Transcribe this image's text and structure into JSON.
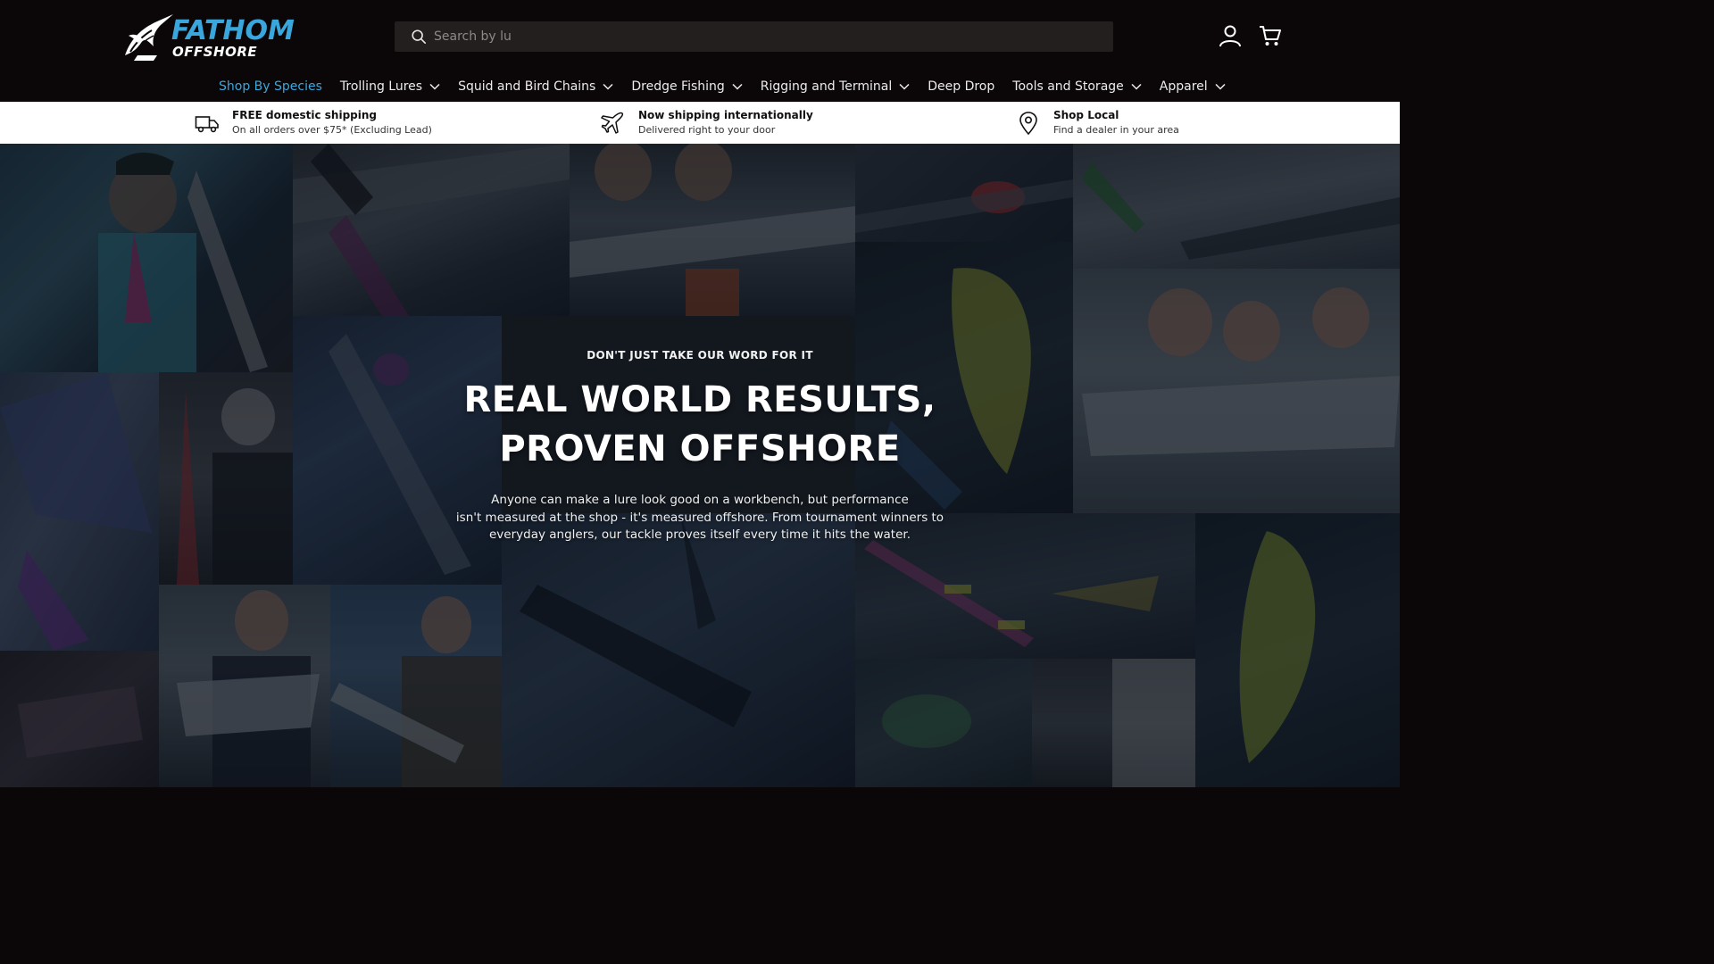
{
  "header": {
    "logo": {
      "brand_line1": "FATHOM",
      "brand_line2": "OFFSHORE",
      "icon": "marlin-logo-icon"
    },
    "search": {
      "placeholder": "Search by lu",
      "icon": "search-icon"
    },
    "account_icon": "user-icon",
    "cart_icon": "cart-icon",
    "accent_color": "#3aa7dc"
  },
  "nav": {
    "items": [
      {
        "label": "Shop By Species",
        "active": true,
        "has_dropdown": false
      },
      {
        "label": "Trolling Lures",
        "active": false,
        "has_dropdown": true
      },
      {
        "label": "Squid and Bird Chains",
        "active": false,
        "has_dropdown": true
      },
      {
        "label": "Dredge Fishing",
        "active": false,
        "has_dropdown": true
      },
      {
        "label": "Rigging and Terminal",
        "active": false,
        "has_dropdown": true
      },
      {
        "label": "Deep Drop",
        "active": false,
        "has_dropdown": false
      },
      {
        "label": "Tools and Storage",
        "active": false,
        "has_dropdown": true
      },
      {
        "label": "Apparel",
        "active": false,
        "has_dropdown": true
      }
    ]
  },
  "benefits": [
    {
      "icon": "truck-icon",
      "title": "FREE domestic shipping",
      "subtitle": "On all orders over $75* (Excluding Lead)"
    },
    {
      "icon": "airplane-icon",
      "title": "Now shipping internationally",
      "subtitle": "Delivered right to your door"
    },
    {
      "icon": "map-pin-icon",
      "title": "Shop Local",
      "subtitle": "Find a dealer in your area"
    }
  ],
  "hero": {
    "eyebrow": "DON'T JUST TAKE OUR WORD FOR IT",
    "headline_line1": "REAL WORLD RESULTS,",
    "headline_line2": "PROVEN OFFSHORE",
    "body_line1": "Anyone can make a lure look good on a workbench, but performance",
    "body_line2": "isn't measured at the shop - it's measured offshore. From tournament winners to",
    "body_line3": "everyday anglers, our tackle proves itself every time it hits the water."
  },
  "colors": {
    "header_bg": "#0b0708",
    "search_bg": "#231f1e",
    "benefits_bg": "#ffffff"
  }
}
